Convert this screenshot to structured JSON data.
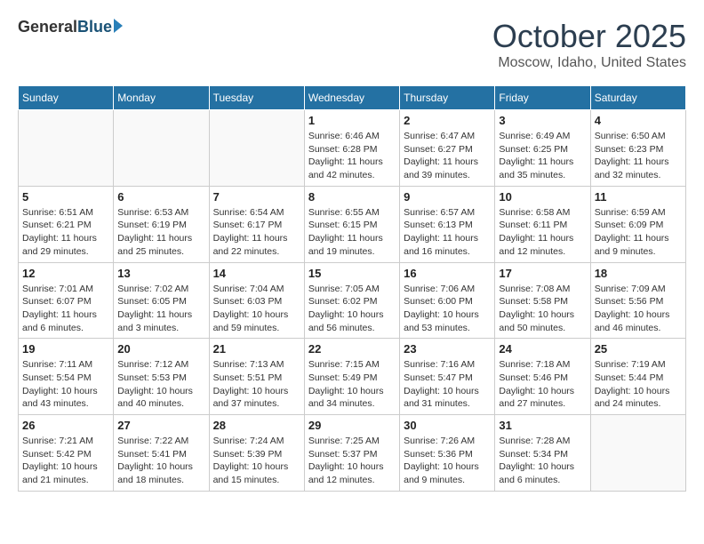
{
  "header": {
    "logo_general": "General",
    "logo_blue": "Blue",
    "title": "October 2025",
    "location": "Moscow, Idaho, United States"
  },
  "days_of_week": [
    "Sunday",
    "Monday",
    "Tuesday",
    "Wednesday",
    "Thursday",
    "Friday",
    "Saturday"
  ],
  "weeks": [
    [
      {
        "day": "",
        "info": ""
      },
      {
        "day": "",
        "info": ""
      },
      {
        "day": "",
        "info": ""
      },
      {
        "day": "1",
        "info": "Sunrise: 6:46 AM\nSunset: 6:28 PM\nDaylight: 11 hours\nand 42 minutes."
      },
      {
        "day": "2",
        "info": "Sunrise: 6:47 AM\nSunset: 6:27 PM\nDaylight: 11 hours\nand 39 minutes."
      },
      {
        "day": "3",
        "info": "Sunrise: 6:49 AM\nSunset: 6:25 PM\nDaylight: 11 hours\nand 35 minutes."
      },
      {
        "day": "4",
        "info": "Sunrise: 6:50 AM\nSunset: 6:23 PM\nDaylight: 11 hours\nand 32 minutes."
      }
    ],
    [
      {
        "day": "5",
        "info": "Sunrise: 6:51 AM\nSunset: 6:21 PM\nDaylight: 11 hours\nand 29 minutes."
      },
      {
        "day": "6",
        "info": "Sunrise: 6:53 AM\nSunset: 6:19 PM\nDaylight: 11 hours\nand 25 minutes."
      },
      {
        "day": "7",
        "info": "Sunrise: 6:54 AM\nSunset: 6:17 PM\nDaylight: 11 hours\nand 22 minutes."
      },
      {
        "day": "8",
        "info": "Sunrise: 6:55 AM\nSunset: 6:15 PM\nDaylight: 11 hours\nand 19 minutes."
      },
      {
        "day": "9",
        "info": "Sunrise: 6:57 AM\nSunset: 6:13 PM\nDaylight: 11 hours\nand 16 minutes."
      },
      {
        "day": "10",
        "info": "Sunrise: 6:58 AM\nSunset: 6:11 PM\nDaylight: 11 hours\nand 12 minutes."
      },
      {
        "day": "11",
        "info": "Sunrise: 6:59 AM\nSunset: 6:09 PM\nDaylight: 11 hours\nand 9 minutes."
      }
    ],
    [
      {
        "day": "12",
        "info": "Sunrise: 7:01 AM\nSunset: 6:07 PM\nDaylight: 11 hours\nand 6 minutes."
      },
      {
        "day": "13",
        "info": "Sunrise: 7:02 AM\nSunset: 6:05 PM\nDaylight: 11 hours\nand 3 minutes."
      },
      {
        "day": "14",
        "info": "Sunrise: 7:04 AM\nSunset: 6:03 PM\nDaylight: 10 hours\nand 59 minutes."
      },
      {
        "day": "15",
        "info": "Sunrise: 7:05 AM\nSunset: 6:02 PM\nDaylight: 10 hours\nand 56 minutes."
      },
      {
        "day": "16",
        "info": "Sunrise: 7:06 AM\nSunset: 6:00 PM\nDaylight: 10 hours\nand 53 minutes."
      },
      {
        "day": "17",
        "info": "Sunrise: 7:08 AM\nSunset: 5:58 PM\nDaylight: 10 hours\nand 50 minutes."
      },
      {
        "day": "18",
        "info": "Sunrise: 7:09 AM\nSunset: 5:56 PM\nDaylight: 10 hours\nand 46 minutes."
      }
    ],
    [
      {
        "day": "19",
        "info": "Sunrise: 7:11 AM\nSunset: 5:54 PM\nDaylight: 10 hours\nand 43 minutes."
      },
      {
        "day": "20",
        "info": "Sunrise: 7:12 AM\nSunset: 5:53 PM\nDaylight: 10 hours\nand 40 minutes."
      },
      {
        "day": "21",
        "info": "Sunrise: 7:13 AM\nSunset: 5:51 PM\nDaylight: 10 hours\nand 37 minutes."
      },
      {
        "day": "22",
        "info": "Sunrise: 7:15 AM\nSunset: 5:49 PM\nDaylight: 10 hours\nand 34 minutes."
      },
      {
        "day": "23",
        "info": "Sunrise: 7:16 AM\nSunset: 5:47 PM\nDaylight: 10 hours\nand 31 minutes."
      },
      {
        "day": "24",
        "info": "Sunrise: 7:18 AM\nSunset: 5:46 PM\nDaylight: 10 hours\nand 27 minutes."
      },
      {
        "day": "25",
        "info": "Sunrise: 7:19 AM\nSunset: 5:44 PM\nDaylight: 10 hours\nand 24 minutes."
      }
    ],
    [
      {
        "day": "26",
        "info": "Sunrise: 7:21 AM\nSunset: 5:42 PM\nDaylight: 10 hours\nand 21 minutes."
      },
      {
        "day": "27",
        "info": "Sunrise: 7:22 AM\nSunset: 5:41 PM\nDaylight: 10 hours\nand 18 minutes."
      },
      {
        "day": "28",
        "info": "Sunrise: 7:24 AM\nSunset: 5:39 PM\nDaylight: 10 hours\nand 15 minutes."
      },
      {
        "day": "29",
        "info": "Sunrise: 7:25 AM\nSunset: 5:37 PM\nDaylight: 10 hours\nand 12 minutes."
      },
      {
        "day": "30",
        "info": "Sunrise: 7:26 AM\nSunset: 5:36 PM\nDaylight: 10 hours\nand 9 minutes."
      },
      {
        "day": "31",
        "info": "Sunrise: 7:28 AM\nSunset: 5:34 PM\nDaylight: 10 hours\nand 6 minutes."
      },
      {
        "day": "",
        "info": ""
      }
    ]
  ]
}
